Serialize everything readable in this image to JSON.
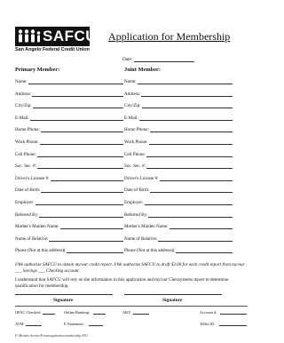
{
  "logo": {
    "word": "SAFCU",
    "subtitle": "San Angelo Federal Credit Union"
  },
  "title": "Application for Membership",
  "date_label": "Date:",
  "primary_heading": "Primary Member:",
  "joint_heading": "Joint Member:",
  "fields": [
    "Name:",
    "Address:",
    "City/Zip:",
    "E-Mail:",
    "Home Phone:",
    "Work Phone:",
    "Cell Phone:",
    "Soc. Sec. #:",
    "Driver's License #:",
    "Date of Birth:",
    "Employer:",
    "Referred By:",
    "Mother's Maiden Name:",
    "Name of Relative:",
    "Phone (Not at this address)("
  ],
  "authorization": "I/We authorize SAFCU to obtain my/our credit report. I/We authorize SAFCU to draft $3.00 for each credit report from my/our ___ Savings ___ Checking account.",
  "understand": "I understand that SAFCU will rely on the information in this application and my/our Chexsystems report to determine qualification for membership.",
  "signature_label": "Signature",
  "office": {
    "ofac": "OFAC Checked:",
    "online": "Online Banking:",
    "art": "ART:",
    "account": "Account #:",
    "atm": "ATM:",
    "estatement": "E-Statement:",
    "teller": "Teller ID:"
  },
  "footer": "F:\\Member Service\\Forms\\application membership 2011"
}
